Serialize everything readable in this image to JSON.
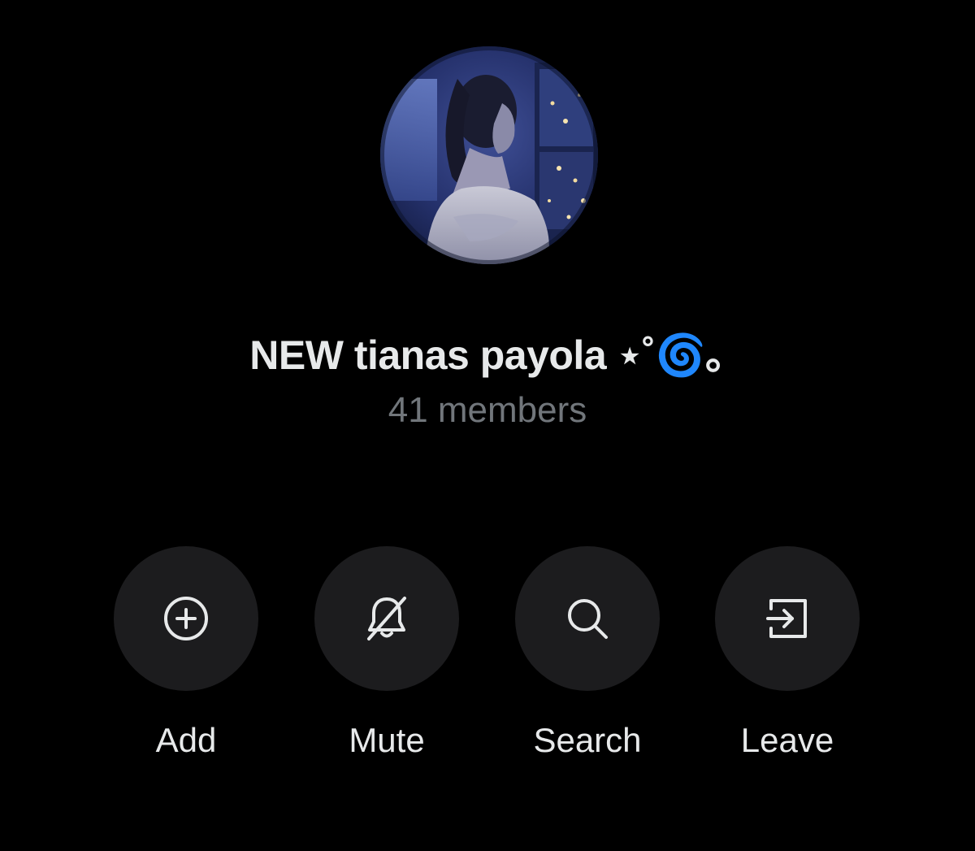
{
  "group": {
    "name": "NEW tianas payola ⋆˚🌀｡",
    "members_text": "41 members"
  },
  "actions": [
    {
      "label": "Add",
      "icon": "add-circle-icon"
    },
    {
      "label": "Mute",
      "icon": "bell-slash-icon"
    },
    {
      "label": "Search",
      "icon": "search-icon"
    },
    {
      "label": "Leave",
      "icon": "leave-icon"
    }
  ],
  "colors": {
    "background": "#000000",
    "primary_text": "#e7e9ea",
    "secondary_text": "#71767b",
    "button_bg": "#1c1c1e"
  }
}
